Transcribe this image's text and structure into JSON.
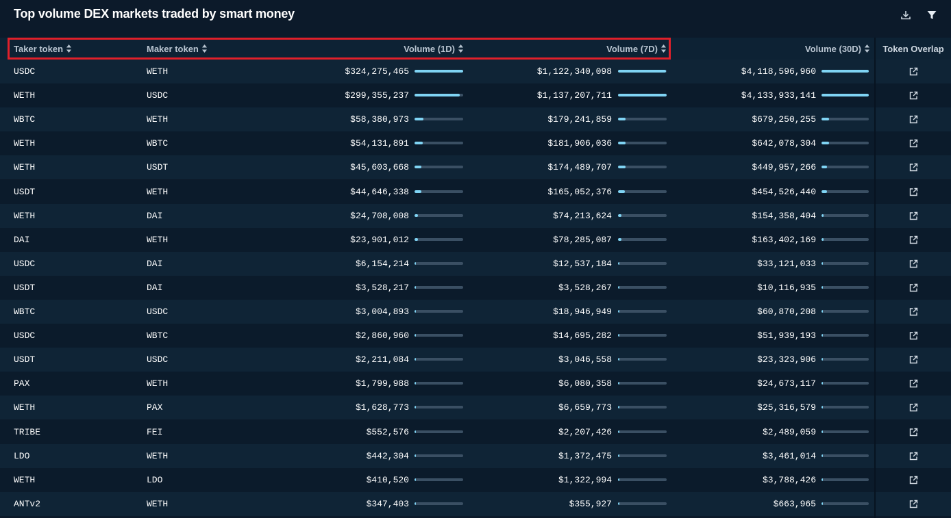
{
  "header": {
    "title": "Top volume DEX markets traded by smart money",
    "icons": [
      "download-icon",
      "filter-icon"
    ]
  },
  "columns": {
    "taker": "Taker token",
    "maker": "Maker token",
    "v1": "Volume (1D)",
    "v7": "Volume (7D)",
    "v30": "Volume (30D)",
    "overlap": "Token Overlap"
  },
  "colors": {
    "bar_fill": "#7fd4f4",
    "bar_track": "#3a4f63",
    "highlight": "#e0202a"
  },
  "rows": [
    {
      "taker": "USDC",
      "maker": "WETH",
      "v1": "$324,275,465",
      "v7": "$1,122,340,098",
      "v30": "$4,118,596,960"
    },
    {
      "taker": "WETH",
      "maker": "USDC",
      "v1": "$299,355,237",
      "v7": "$1,137,207,711",
      "v30": "$4,133,933,141"
    },
    {
      "taker": "WBTC",
      "maker": "WETH",
      "v1": "$58,380,973",
      "v7": "$179,241,859",
      "v30": "$679,250,255"
    },
    {
      "taker": "WETH",
      "maker": "WBTC",
      "v1": "$54,131,891",
      "v7": "$181,906,036",
      "v30": "$642,078,304"
    },
    {
      "taker": "WETH",
      "maker": "USDT",
      "v1": "$45,603,668",
      "v7": "$174,489,707",
      "v30": "$449,957,266"
    },
    {
      "taker": "USDT",
      "maker": "WETH",
      "v1": "$44,646,338",
      "v7": "$165,052,376",
      "v30": "$454,526,440"
    },
    {
      "taker": "WETH",
      "maker": "DAI",
      "v1": "$24,708,008",
      "v7": "$74,213,624",
      "v30": "$154,358,404"
    },
    {
      "taker": "DAI",
      "maker": "WETH",
      "v1": "$23,901,012",
      "v7": "$78,285,087",
      "v30": "$163,402,169"
    },
    {
      "taker": "USDC",
      "maker": "DAI",
      "v1": "$6,154,214",
      "v7": "$12,537,184",
      "v30": "$33,121,033"
    },
    {
      "taker": "USDT",
      "maker": "DAI",
      "v1": "$3,528,217",
      "v7": "$3,528,267",
      "v30": "$10,116,935"
    },
    {
      "taker": "WBTC",
      "maker": "USDC",
      "v1": "$3,004,893",
      "v7": "$18,946,949",
      "v30": "$60,870,208"
    },
    {
      "taker": "USDC",
      "maker": "WBTC",
      "v1": "$2,860,960",
      "v7": "$14,695,282",
      "v30": "$51,939,193"
    },
    {
      "taker": "USDT",
      "maker": "USDC",
      "v1": "$2,211,084",
      "v7": "$3,046,558",
      "v30": "$23,323,906"
    },
    {
      "taker": "PAX",
      "maker": "WETH",
      "v1": "$1,799,988",
      "v7": "$6,080,358",
      "v30": "$24,673,117"
    },
    {
      "taker": "WETH",
      "maker": "PAX",
      "v1": "$1,628,773",
      "v7": "$6,659,773",
      "v30": "$25,316,579"
    },
    {
      "taker": "TRIBE",
      "maker": "FEI",
      "v1": "$552,576",
      "v7": "$2,207,426",
      "v30": "$2,489,059"
    },
    {
      "taker": "LDO",
      "maker": "WETH",
      "v1": "$442,304",
      "v7": "$1,372,475",
      "v30": "$3,461,014"
    },
    {
      "taker": "WETH",
      "maker": "LDO",
      "v1": "$410,520",
      "v7": "$1,322,994",
      "v30": "$3,788,426"
    },
    {
      "taker": "ANTv2",
      "maker": "WETH",
      "v1": "$347,403",
      "v7": "$355,927",
      "v30": "$663,965"
    }
  ]
}
